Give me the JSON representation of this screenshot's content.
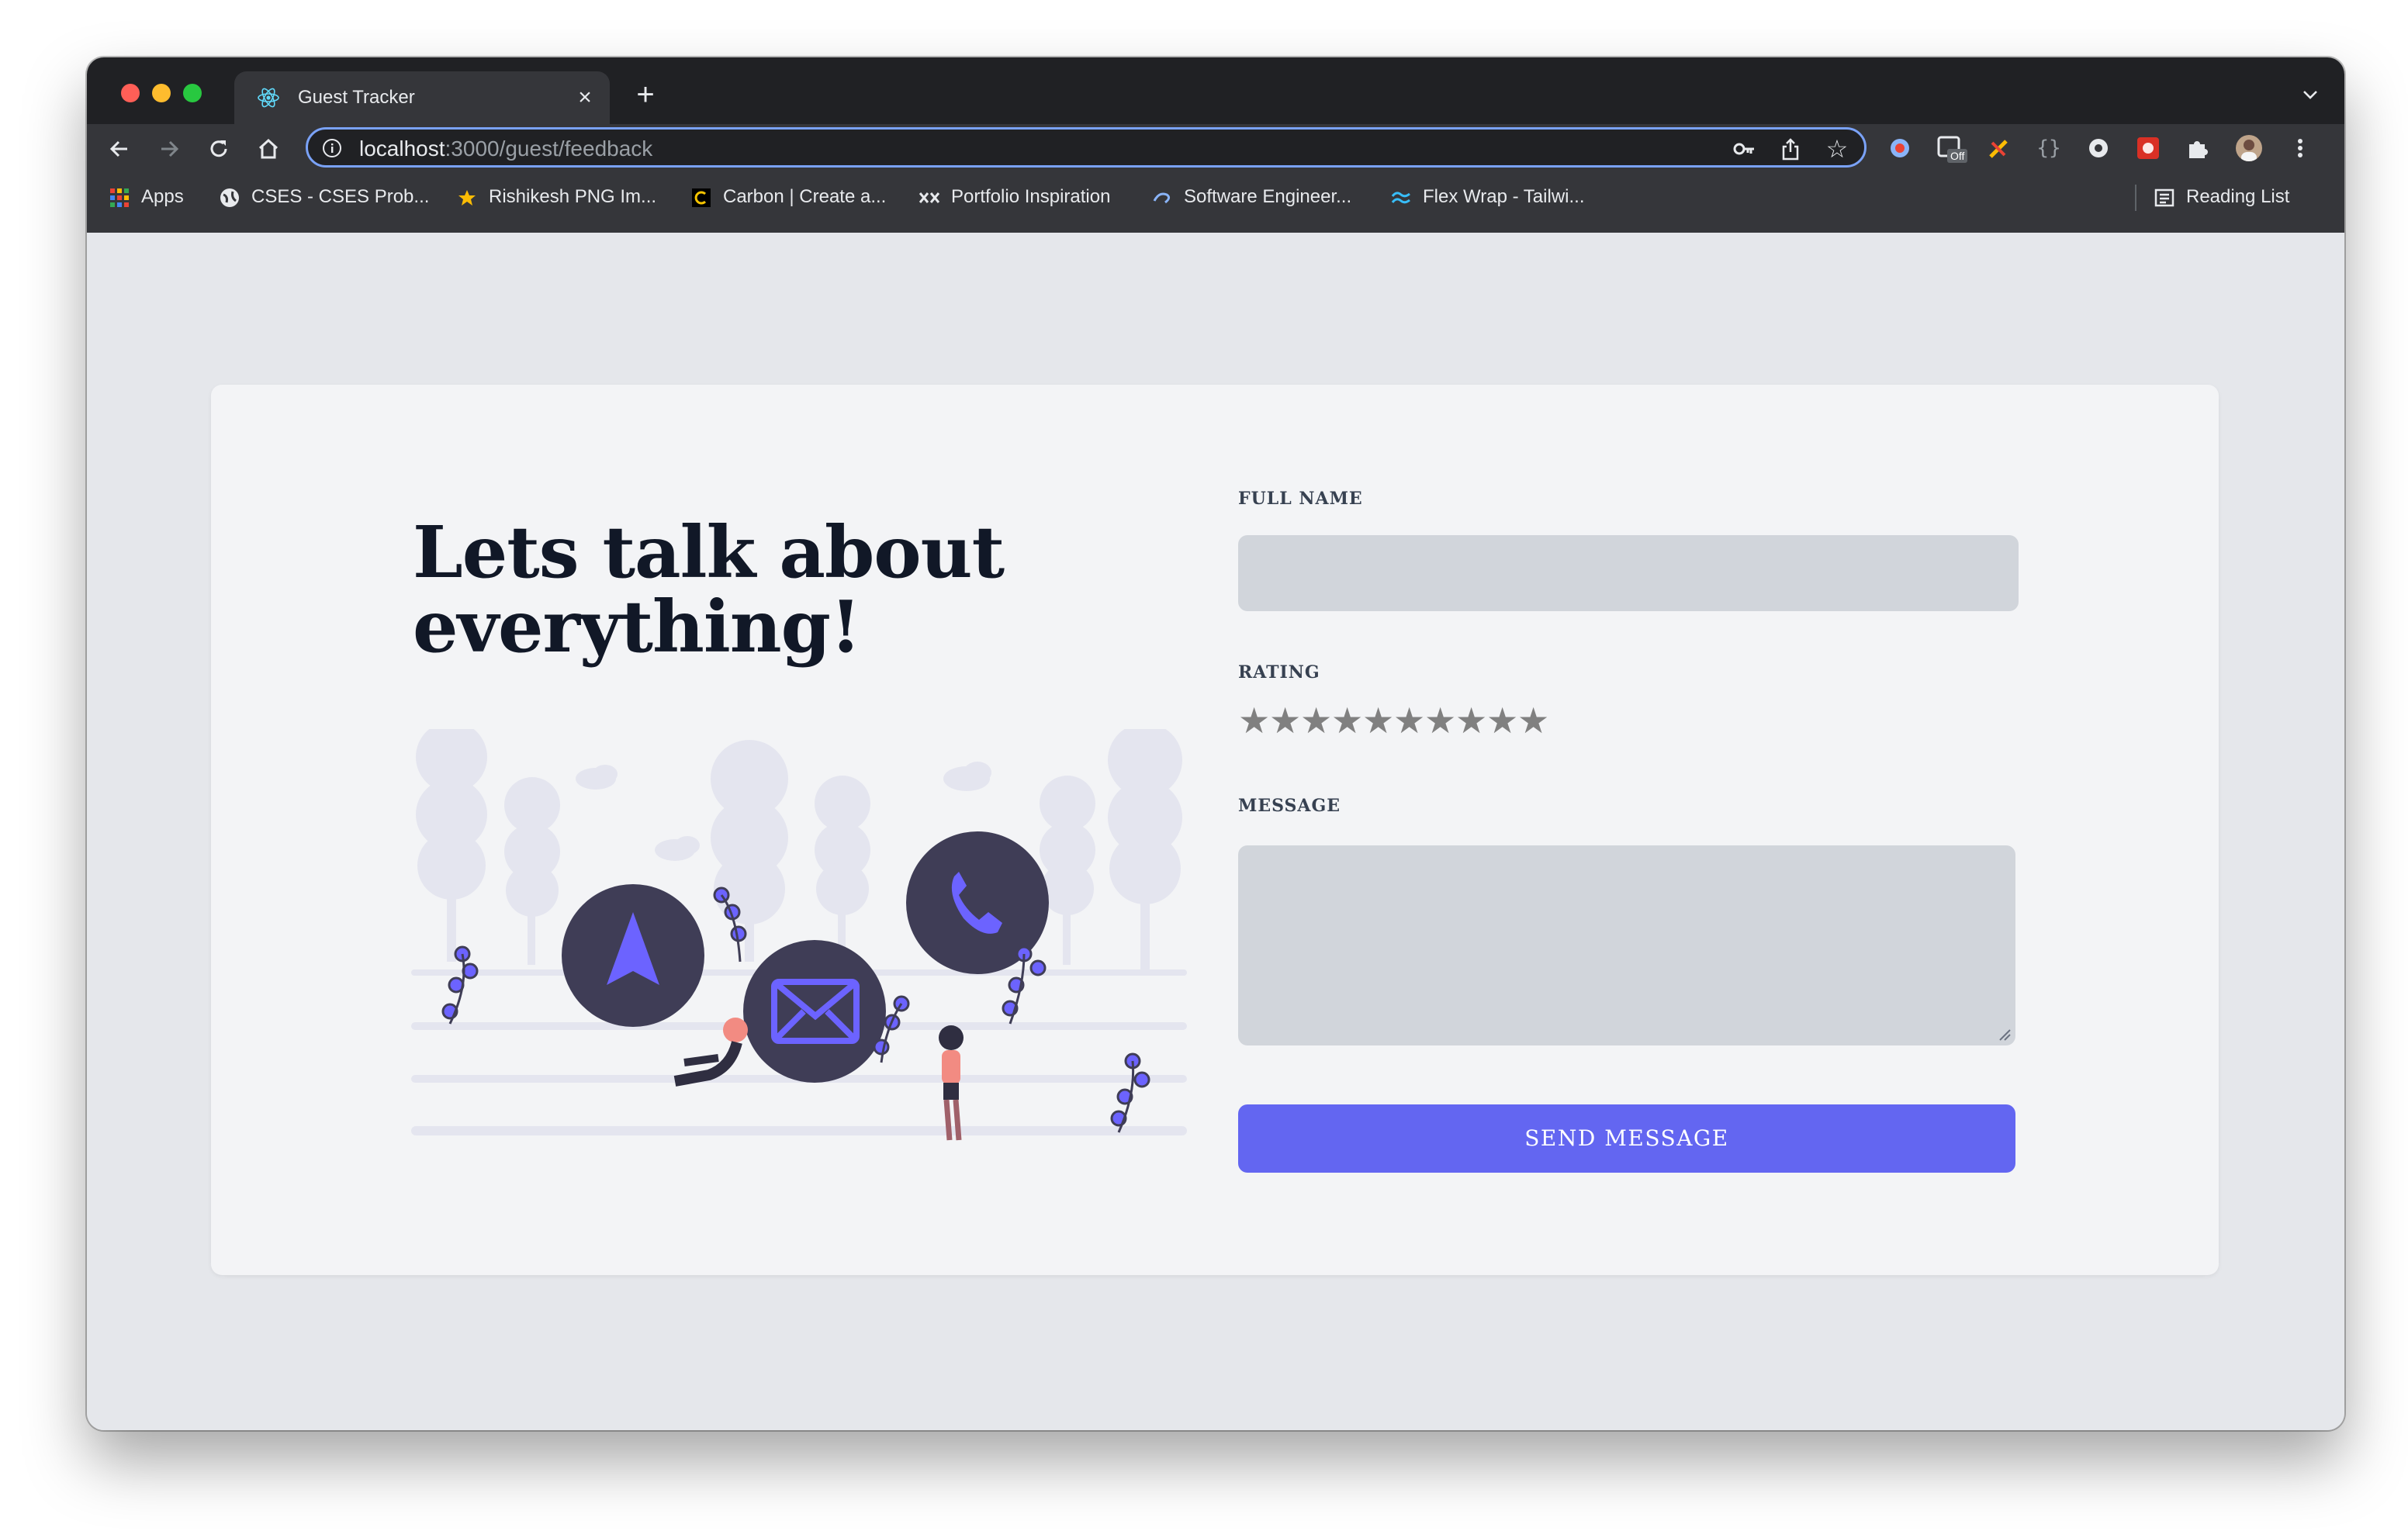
{
  "browser": {
    "tab_title": "Guest Tracker",
    "url_host": "localhost",
    "url_path": ":3000/guest/feedback",
    "bookmarks": [
      {
        "label": "Apps",
        "icon": "apps-grid-icon"
      },
      {
        "label": "CSES - CSES Prob...",
        "icon": "globe-icon"
      },
      {
        "label": "Rishikesh PNG Im...",
        "icon": "star-badge-icon"
      },
      {
        "label": "Carbon | Create a...",
        "icon": "carbon-icon"
      },
      {
        "label": "Portfolio Inspiration",
        "icon": "xx-logo-icon"
      },
      {
        "label": "Software Engineer...",
        "icon": "swirl-icon"
      },
      {
        "label": "Flex Wrap - Tailwi...",
        "icon": "tailwind-icon"
      }
    ],
    "reading_list": "Reading List",
    "extension_badge": "Off"
  },
  "page": {
    "headline_line1": "Lets talk about",
    "headline_line2": "everything!",
    "full_name_label": "FULL NAME",
    "full_name_value": "",
    "rating_label": "RATING",
    "rating_value": 0,
    "rating_max": 10,
    "star_glyph": "★",
    "message_label": "MESSAGE",
    "message_value": "",
    "send_label": "SEND MESSAGE"
  },
  "colors": {
    "accent": "#6366f1",
    "page_bg": "#e5e7eb",
    "card_bg": "#f3f4f6",
    "input_bg": "#d1d5db",
    "star": "#808080",
    "headline": "#111827"
  }
}
